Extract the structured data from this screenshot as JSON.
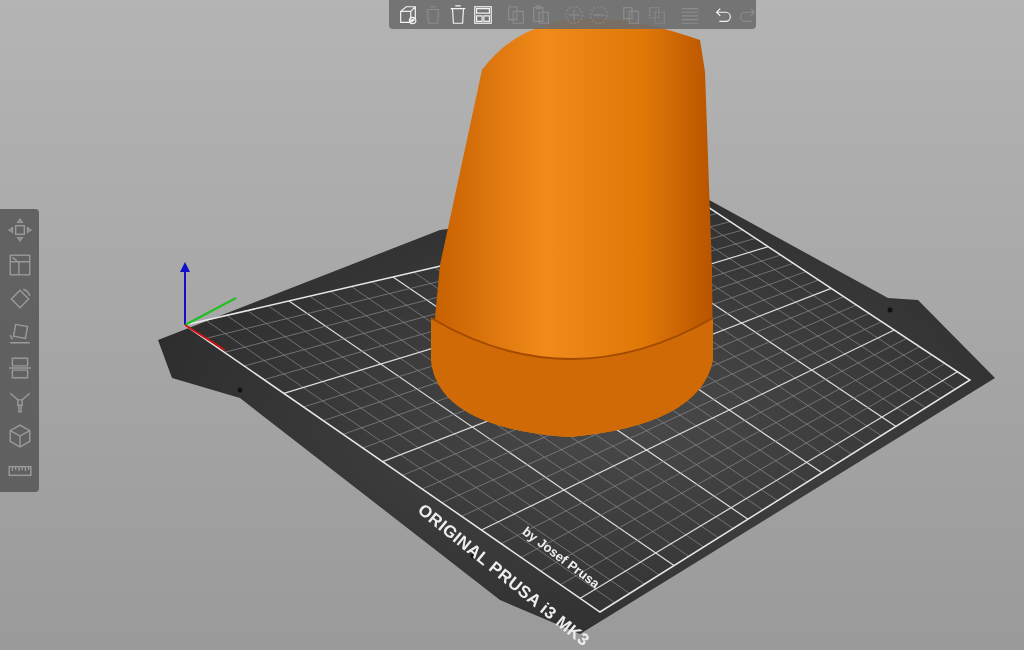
{
  "top_toolbar": {
    "buttons": [
      {
        "kind": "add",
        "enabled": true
      },
      {
        "kind": "delete",
        "enabled": false
      },
      {
        "kind": "delete_all",
        "enabled": true
      },
      {
        "kind": "arrange",
        "enabled": true
      },
      {
        "kind": "copy",
        "enabled": false
      },
      {
        "kind": "paste",
        "enabled": false
      },
      {
        "kind": "add_instance",
        "enabled": false
      },
      {
        "kind": "remove_instance",
        "enabled": false
      },
      {
        "kind": "split_objects",
        "enabled": false
      },
      {
        "kind": "split_parts",
        "enabled": false
      },
      {
        "kind": "layers",
        "enabled": false
      },
      {
        "kind": "undo",
        "enabled": true
      },
      {
        "kind": "redo",
        "enabled": false
      }
    ]
  },
  "left_toolbar": {
    "tools": [
      {
        "kind": "move"
      },
      {
        "kind": "scale"
      },
      {
        "kind": "rotate"
      },
      {
        "kind": "place_on_face"
      },
      {
        "kind": "cut"
      },
      {
        "kind": "paint"
      },
      {
        "kind": "hollow"
      },
      {
        "kind": "measure"
      }
    ]
  },
  "bed": {
    "title": "ORIGINAL PRUSA i3 **MK3**",
    "subtitle": "by Josef Prusa"
  }
}
